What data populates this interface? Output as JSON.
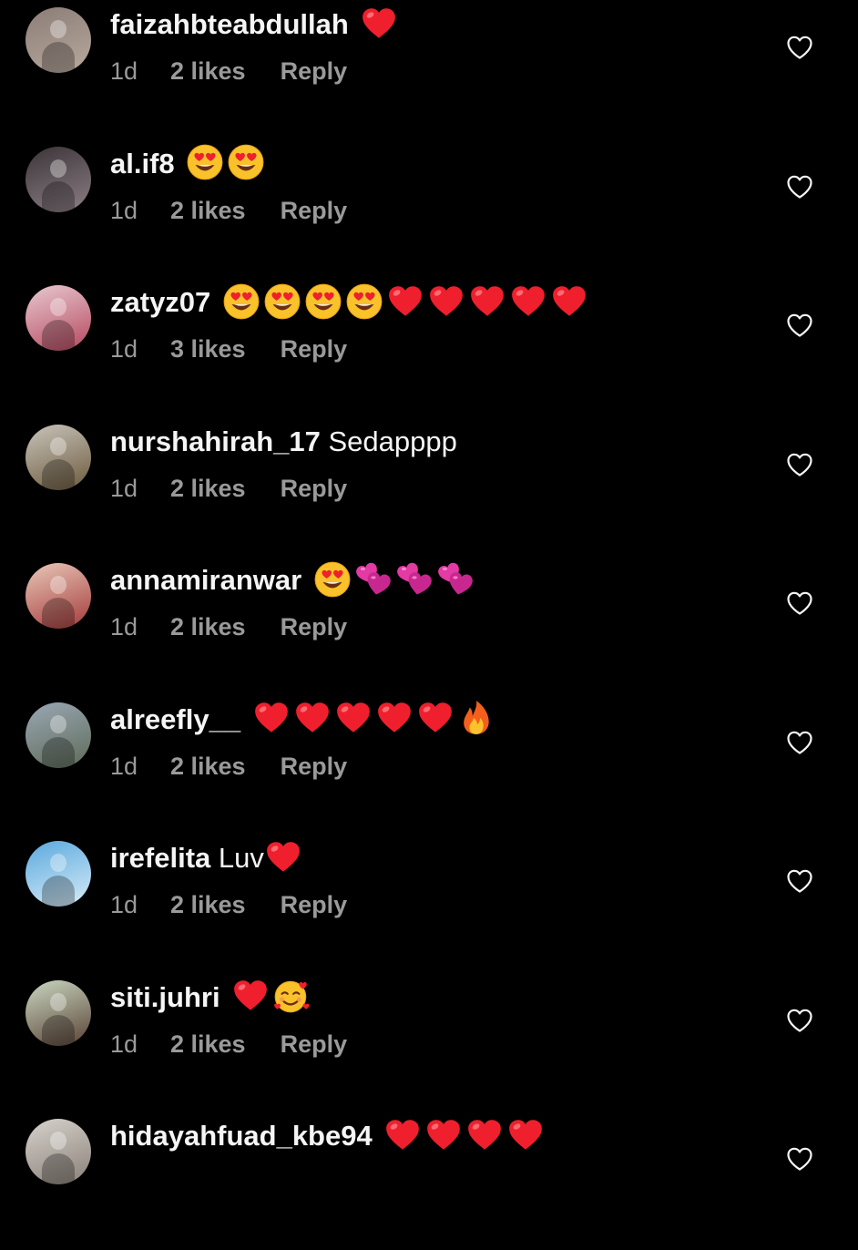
{
  "colors": {
    "background": "#000000",
    "username": "#f5f5f5",
    "meta": "#9a9a9a",
    "heart_outline": "#f5f5f5"
  },
  "comments": [
    {
      "username": "faizahbteabdullah",
      "text": "",
      "emojis": [
        "red-heart"
      ],
      "time": "1d",
      "likes": "2 likes",
      "reply": "Reply",
      "avatar_colors": [
        "#8a7d76",
        "#b9a99e"
      ]
    },
    {
      "username": "al.if8",
      "text": "",
      "emojis": [
        "heart-eyes",
        "heart-eyes"
      ],
      "time": "1d",
      "likes": "2 likes",
      "reply": "Reply",
      "avatar_colors": [
        "#3a3437",
        "#8d7f86"
      ]
    },
    {
      "username": "zatyz07",
      "text": "",
      "emojis": [
        "heart-eyes",
        "heart-eyes",
        "heart-eyes",
        "heart-eyes",
        "red-heart",
        "red-heart",
        "red-heart",
        "red-heart",
        "red-heart"
      ],
      "time": "1d",
      "likes": "3 likes",
      "reply": "Reply",
      "avatar_colors": [
        "#e7c9cf",
        "#b6485f"
      ]
    },
    {
      "username": "nurshahirah_17",
      "text": "Sedapppp",
      "emojis": [],
      "time": "1d",
      "likes": "2 likes",
      "reply": "Reply",
      "avatar_colors": [
        "#c8c4bb",
        "#6d5a3d"
      ]
    },
    {
      "username": "annamiranwar",
      "text": "",
      "emojis": [
        "heart-eyes",
        "two-hearts",
        "two-hearts",
        "two-hearts"
      ],
      "time": "1d",
      "likes": "2 likes",
      "reply": "Reply",
      "avatar_colors": [
        "#e8c8b8",
        "#a43a3a"
      ]
    },
    {
      "username": "alreefly__",
      "text": "",
      "emojis": [
        "red-heart",
        "red-heart",
        "red-heart",
        "red-heart",
        "red-heart",
        "fire"
      ],
      "time": "1d",
      "likes": "2 likes",
      "reply": "Reply",
      "avatar_colors": [
        "#9aa7b4",
        "#5e6b58"
      ]
    },
    {
      "username": "irefelita",
      "text": "Luv",
      "emojis": [
        "red-heart"
      ],
      "time": "1d",
      "likes": "2 likes",
      "reply": "Reply",
      "avatar_colors": [
        "#5aa9de",
        "#d8ecf7"
      ]
    },
    {
      "username": "siti.juhri",
      "text": "",
      "emojis": [
        "red-heart",
        "smiling-hearts"
      ],
      "time": "1d",
      "likes": "2 likes",
      "reply": "Reply",
      "avatar_colors": [
        "#c9d7c0",
        "#5a4236"
      ]
    },
    {
      "username": "hidayahfuad_kbe94",
      "text": "",
      "emojis": [
        "red-heart",
        "red-heart",
        "red-heart",
        "red-heart"
      ],
      "time": "",
      "likes": "",
      "reply": "",
      "avatar_colors": [
        "#d6d2cc",
        "#8a8078"
      ]
    }
  ]
}
